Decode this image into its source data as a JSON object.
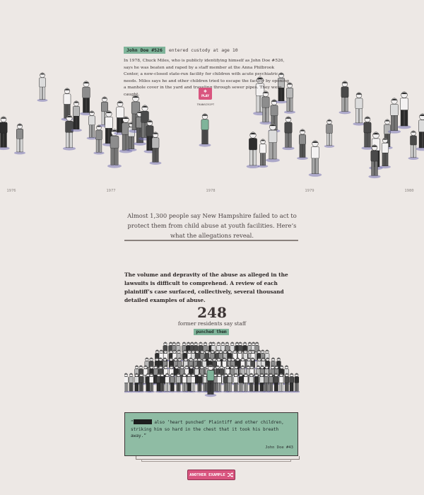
{
  "story": {
    "name_tag": "John Doe #526",
    "entered_text": "entered custody at age 10",
    "body": "In 1978, Chuck Miles, who is publicly identifying himself as John Doe #526, says he was beaten and raped by a staff member at the Anna Philbrook Center, a now-closed state-run facility for children with acute psychiatric needs. Miles says he and other children tried to escape the facility by opening a manhole cover in the yard and traveling through sewer pipes. They were caught.",
    "play_label": "PLAY",
    "transcript_label": "TRANSCRIPT"
  },
  "timeline": {
    "years": [
      "1976",
      "1977",
      "1978",
      "1979",
      "1980"
    ]
  },
  "intro": "Almost 1,300 people say New Hampshire failed to act to protect them from child abuse at youth facilities. Here’s what the allegations reveal.",
  "paragraph": "The volume and depravity of the abuse as alleged in the lawsuits is difficult to comprehend. A review of each plaintiff’s case surfaced, collectively, several thousand detailed examples of abuse.",
  "stat": {
    "number": "248",
    "label": "former residents say staff",
    "tag": "punched them"
  },
  "quote": {
    "open": "“",
    "text_after_redaction": " also ‘heart punched’ Plaintiff and other children, striking him so hard in the chest that it took his breath away.”",
    "attribution": "John Doe #43"
  },
  "another_button": "ANOTHER EXAMPLE",
  "colors": {
    "background": "#ede8e5",
    "accent_green": "#7fb49a",
    "accent_pink": "#d9557f",
    "text": "#3d3636"
  }
}
